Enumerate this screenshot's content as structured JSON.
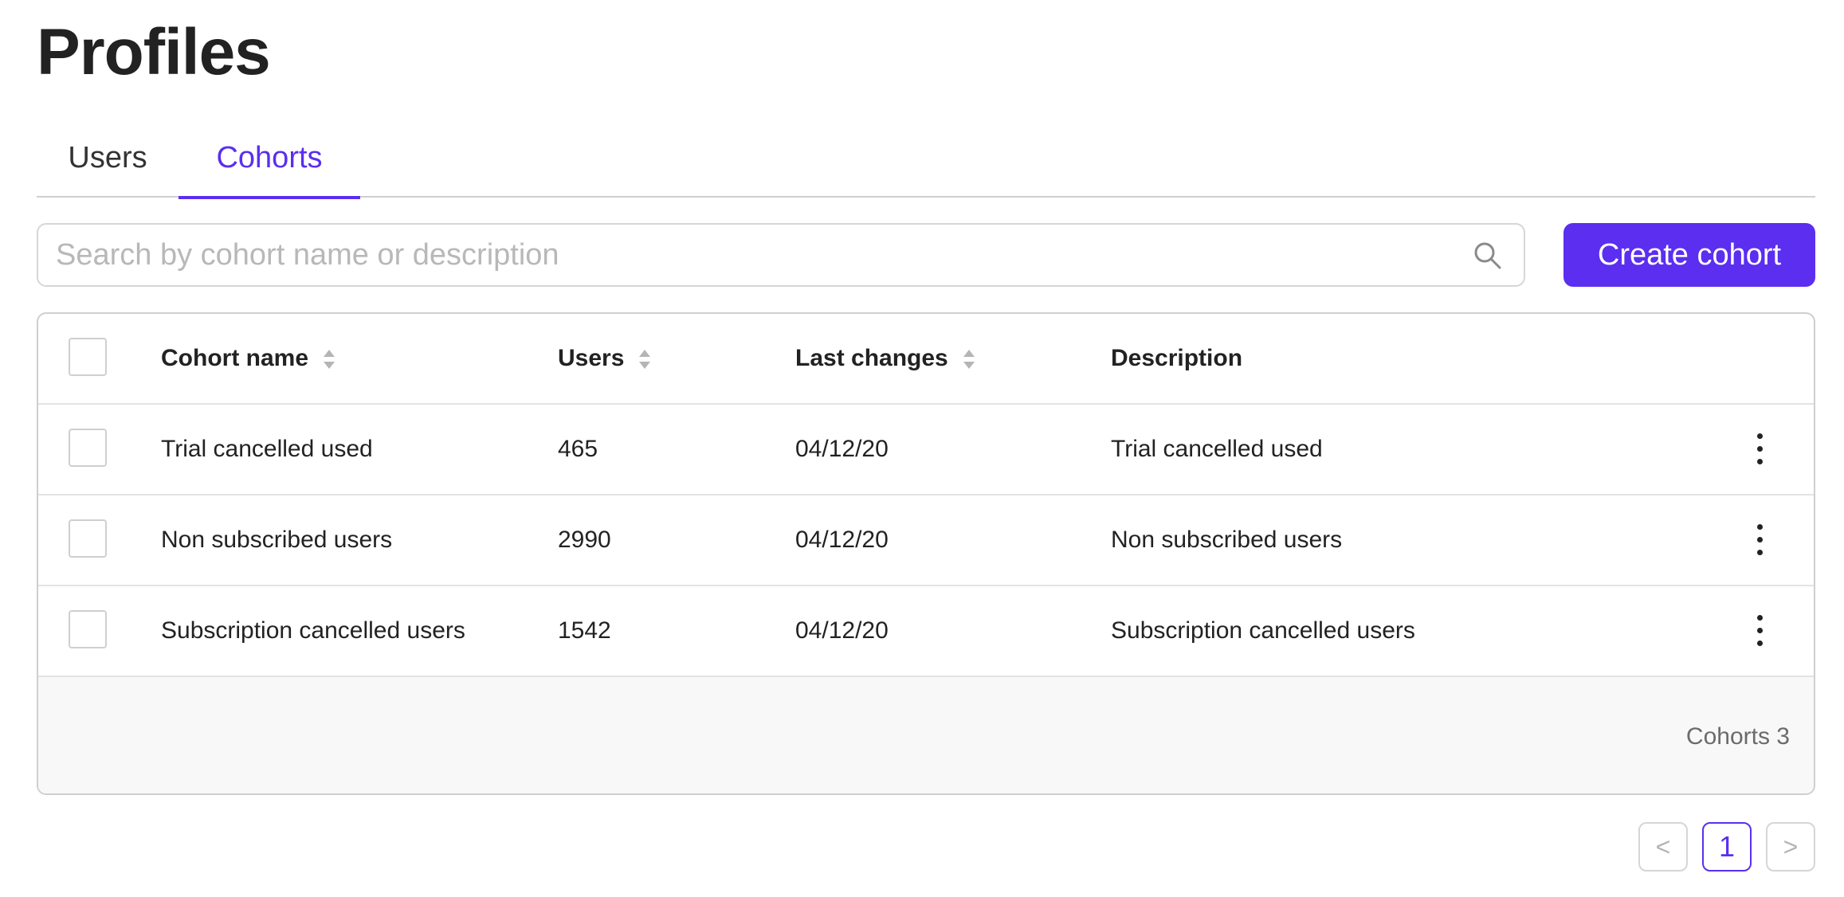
{
  "page": {
    "title": "Profiles"
  },
  "tabs": [
    {
      "label": "Users",
      "active": false
    },
    {
      "label": "Cohorts",
      "active": true
    }
  ],
  "search": {
    "placeholder": "Search by cohort name or description",
    "value": "",
    "icon": "search-icon"
  },
  "actions": {
    "create_label": "Create cohort"
  },
  "table": {
    "columns": {
      "name": "Cohort name",
      "users": "Users",
      "last_changes": "Last changes",
      "description": "Description"
    },
    "rows": [
      {
        "name": "Trial cancelled used",
        "users": "465",
        "last_changes": "04/12/20",
        "description": "Trial cancelled used"
      },
      {
        "name": "Non subscribed users",
        "users": "2990",
        "last_changes": "04/12/20",
        "description": "Non subscribed users"
      },
      {
        "name": "Subscription cancelled users",
        "users": "1542",
        "last_changes": "04/12/20",
        "description": "Subscription cancelled users"
      }
    ],
    "footer": {
      "count_label": "Cohorts 3"
    }
  },
  "pagination": {
    "prev": "<",
    "current": "1",
    "next": ">"
  },
  "colors": {
    "accent": "#5b2ef0",
    "border": "#cfcfcf",
    "footer_bg": "#f8f8f8"
  }
}
